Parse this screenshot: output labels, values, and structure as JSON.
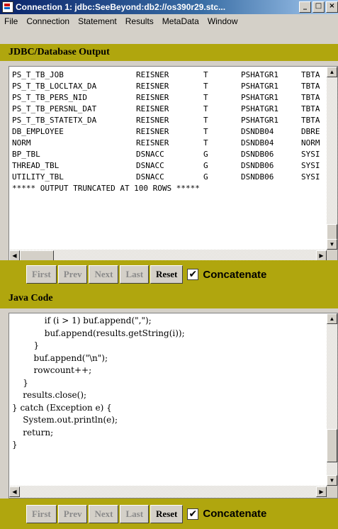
{
  "window": {
    "title": "Connection 1: jdbc:SeeBeyond:db2://os390r29.stc...",
    "minimize": "_",
    "maximize": "□",
    "close": "×"
  },
  "menu": [
    "File",
    "Connection",
    "Statement",
    "Results",
    "MetaData",
    "Window"
  ],
  "jdbc_output": {
    "heading": "JDBC/Database Output",
    "rows": [
      [
        "PS_T_TB_JOB",
        "REISNER",
        "T",
        "PSHATGR1",
        "TBTA"
      ],
      [
        "PS_T_TB_LOCLTAX_DA",
        "REISNER",
        "T",
        "PSHATGR1",
        "TBTA"
      ],
      [
        "PS_T_TB_PERS_NID",
        "REISNER",
        "T",
        "PSHATGR1",
        "TBTA"
      ],
      [
        "PS_T_TB_PERSNL_DAT",
        "REISNER",
        "T",
        "PSHATGR1",
        "TBTA"
      ],
      [
        "PS_T_TB_STATETX_DA",
        "REISNER",
        "T",
        "PSHATGR1",
        "TBTA"
      ],
      [
        "DB_EMPLOYEE",
        "REISNER",
        "T",
        "DSNDB04",
        "DBRE"
      ],
      [
        "NORM",
        "REISNER",
        "T",
        "DSNDB04",
        "NORM"
      ],
      [
        "BP_TBL",
        "DSNACC",
        "G",
        "DSNDB06",
        "SYSI"
      ],
      [
        "THREAD_TBL",
        "DSNACC",
        "G",
        "DSNDB06",
        "SYSI"
      ],
      [
        "UTILITY_TBL",
        "DSNACC",
        "G",
        "DSNDB06",
        "SYSI"
      ]
    ],
    "truncated_msg": "***** OUTPUT TRUNCATED AT 100 ROWS *****"
  },
  "buttons": {
    "first": "First",
    "prev": "Prev",
    "next": "Next",
    "last": "Last",
    "reset": "Reset",
    "concatenate": "Concatenate",
    "concatenate_checked": true
  },
  "java_code": {
    "heading": "Java Code",
    "lines": [
      "            if (i > 1) buf.append(\",\");",
      "            buf.append(results.getString(i));",
      "        }",
      "        buf.append(\"\\n\");",
      "        rowcount++;",
      "    }",
      "    results.close();",
      "} catch (Exception e) {",
      "    System.out.println(e);",
      "    return;",
      "}"
    ]
  },
  "icons": [
    "app-icon",
    "scroll-up-icon",
    "scroll-down-icon",
    "scroll-left-icon",
    "scroll-right-icon",
    "checkmark-icon"
  ]
}
